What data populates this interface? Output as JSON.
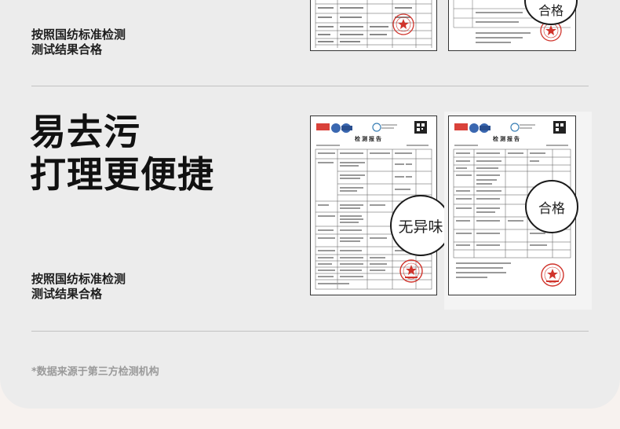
{
  "top_section": {
    "note_line1": "按照国纺标准检测",
    "note_line2": "测试结果合格"
  },
  "middle_section": {
    "heading_line1": "易去污",
    "heading_line2": "打理更便捷",
    "note_line1": "按照国纺标准检测",
    "note_line2": "测试结果合格"
  },
  "certificates": {
    "report_title": "检测报告",
    "top_right_zoom_label": "合格",
    "middle_left_zoom_label": "无异味",
    "middle_right_zoom_label": "合格"
  },
  "footnote": "*数据来源于第三方检测机构",
  "colors": {
    "stamp_red": "#d0342c",
    "panel_bg": "#ececec",
    "page_bg": "#f7f2ef",
    "logo_red": "#d9423a",
    "logo_blue": "#3a67b0"
  }
}
